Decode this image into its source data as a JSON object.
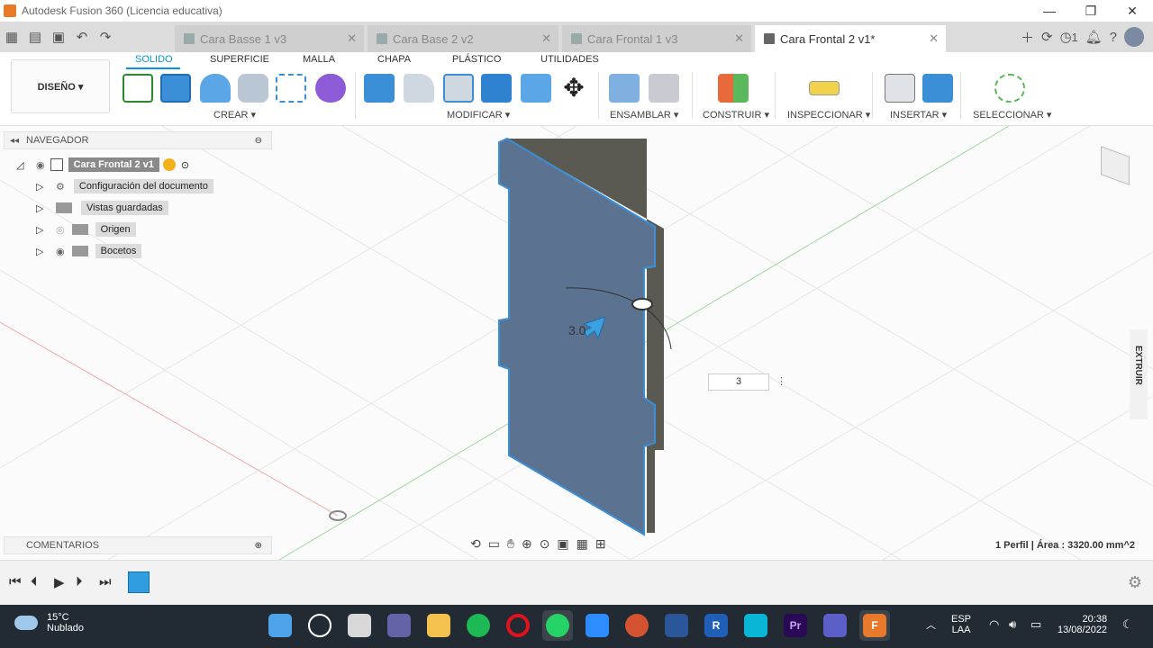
{
  "window": {
    "title": "Autodesk Fusion 360 (Licencia educativa)"
  },
  "tabs": [
    {
      "label": "Cara Basse 1 v3"
    },
    {
      "label": "Cara Base 2 v2"
    },
    {
      "label": "Cara Frontal 1 v3"
    },
    {
      "label": "Cara Frontal 2 v1*"
    }
  ],
  "header": {
    "job_count": "1"
  },
  "toolbar": {
    "workspace": "DISEÑO ▾",
    "tabs": [
      "SOLIDO",
      "SUPERFICIE",
      "MALLA",
      "CHAPA",
      "PLÁSTICO",
      "UTILIDADES"
    ],
    "groups": {
      "create": "CREAR ▾",
      "modify": "MODIFICAR ▾",
      "assemble": "ENSAMBLAR ▾",
      "construct": "CONSTRUIR ▾",
      "inspect": "INSPECCIONAR ▾",
      "insert": "INSERTAR ▾",
      "select": "SELECCIONAR ▾"
    }
  },
  "navigator": {
    "title": "NAVEGADOR",
    "root": "Cara Frontal 2 v1",
    "items": [
      {
        "label": "Configuración del documento"
      },
      {
        "label": "Vistas guardadas"
      },
      {
        "label": "Origen"
      },
      {
        "label": "Bocetos"
      }
    ]
  },
  "comments": {
    "title": "COMENTARIOS"
  },
  "viewport": {
    "dimension_label": "3.0",
    "dimension_input": "3",
    "extrude_panel": "EXTRUIR",
    "status": "1 Perfil | Área : 3320.00 mm^2"
  },
  "taskbar": {
    "weather_temp": "15°C",
    "weather_desc": "Nublado",
    "lang1": "ESP",
    "lang2": "LAA",
    "time": "20:38",
    "date": "13/08/2022",
    "badges": {
      "revit": "R",
      "premiere": "Pr",
      "f360": "F"
    }
  },
  "colors": {
    "accent": "#0696d7",
    "body": "#5b7291",
    "taskbar": "#222a33"
  }
}
